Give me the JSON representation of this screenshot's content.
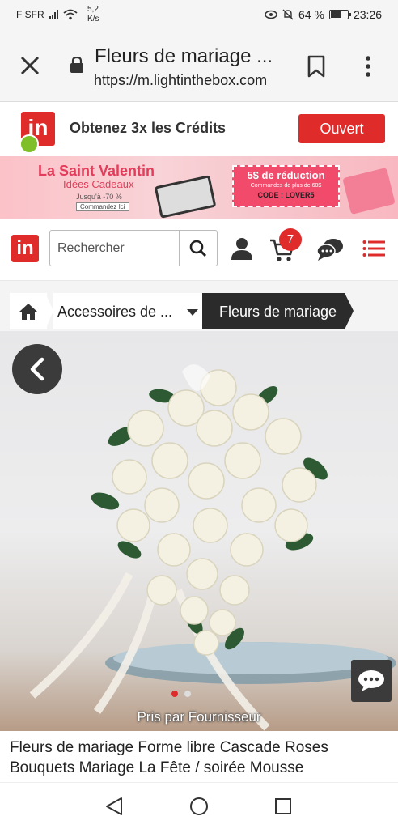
{
  "status_bar": {
    "carrier": "F SFR",
    "speed_value": "5,2",
    "speed_unit": "K/s",
    "battery": "64 %",
    "battery_level": 0.64,
    "time": "23:26"
  },
  "browser": {
    "page_title": "Fleurs de mariage ...",
    "url": "https://m.lightinthebox.com"
  },
  "app_banner": {
    "logo_text": "in",
    "text": "Obtenez 3x les Crédits",
    "open_button": "Ouvert"
  },
  "promo_banner": {
    "title": "La Saint Valentin",
    "subtitle": "Idées Cadeaux",
    "discount": "Jusqu'à -70 %",
    "cta": "Commandez Ici",
    "coupon_title": "5$ de réduction",
    "coupon_condition": "Commandes de plus de 60$",
    "coupon_code": "CODE : LOVER5"
  },
  "header": {
    "logo_text": "in",
    "search_placeholder": "Rechercher",
    "cart_count": "7"
  },
  "breadcrumb": {
    "category": "Accessoires de ...",
    "current": "Fleurs de mariage"
  },
  "product": {
    "image_credit": "Pris par Fournisseur",
    "carousel_total": 2,
    "carousel_active": 1,
    "title": "Fleurs de mariage Forme libre Cascade Roses Bouquets Mariage La Fête / soirée Mousse"
  },
  "colors": {
    "brand_red": "#e02b2b",
    "dark": "#2b2b2b",
    "promo_pink": "#f14a6b"
  }
}
